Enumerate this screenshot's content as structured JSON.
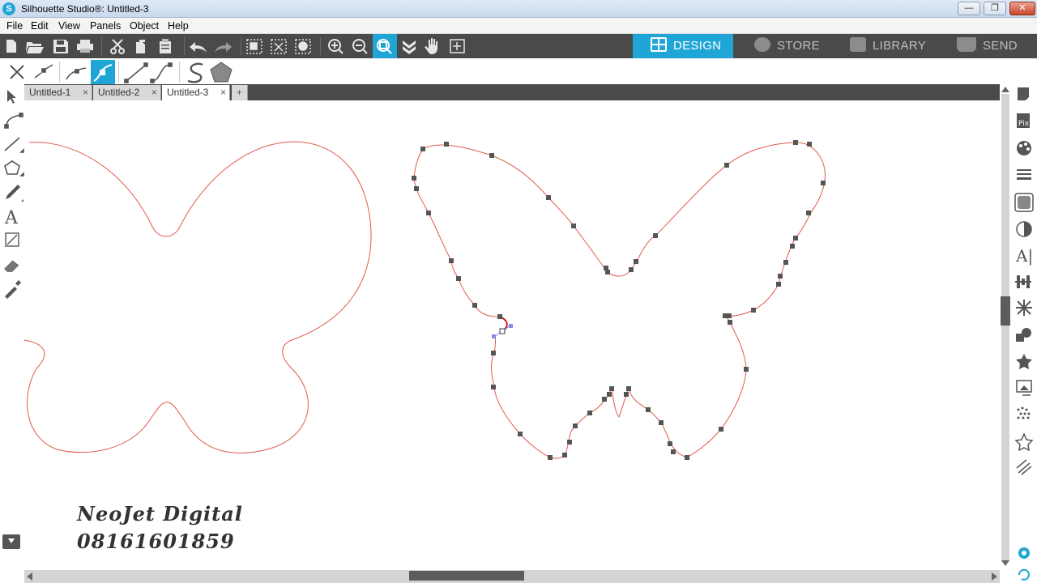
{
  "window": {
    "title": "Silhouette Studio®: Untitled-3",
    "logo": "S",
    "minimize": "—",
    "maximize": "❐",
    "close": "✕"
  },
  "menu": [
    "File",
    "Edit",
    "View",
    "Panels",
    "Object",
    "Help"
  ],
  "nav_tabs": [
    {
      "label": "DESIGN",
      "active": true
    },
    {
      "label": "STORE",
      "active": false
    },
    {
      "label": "LIBRARY",
      "active": false
    },
    {
      "label": "SEND",
      "active": false
    }
  ],
  "doc_tabs": [
    {
      "label": "Untitled-1",
      "close": "×"
    },
    {
      "label": "Untitled-2",
      "close": "×"
    },
    {
      "label": "Untitled-3",
      "close": "×",
      "active": true
    }
  ],
  "add_tab": "+",
  "watermark": {
    "line1": "NeoJet Digital",
    "line2": "08161601859"
  },
  "colors": {
    "accent": "#1fa6d6",
    "toolbar": "#4a4a4a",
    "cut_line": "#e05a4a",
    "point": "#555555"
  },
  "icons": {
    "toolbar": [
      "new-file-icon",
      "open-icon",
      "save-icon",
      "print-icon",
      "cut-icon",
      "copy-icon",
      "paste-icon",
      "undo-icon",
      "redo-icon",
      "group-icon",
      "ungroup-icon",
      "compound-icon",
      "zoom-in-icon",
      "zoom-out-icon",
      "zoom-fit-icon",
      "pan-down-icon",
      "hand-icon",
      "zoom-page-icon"
    ],
    "edit_points": [
      "delete-point-icon",
      "break-path-icon",
      "corner-point-icon",
      "smooth-point-icon",
      "straighten-icon",
      "curve-icon",
      "simplify-icon",
      "polygon-icon"
    ],
    "left_tools": [
      "select-icon",
      "edit-points-icon",
      "line-icon",
      "polygon-icon",
      "pencil-icon",
      "text-icon",
      "knife-icon",
      "eraser-icon",
      "eyedropper-icon"
    ],
    "right_panel": [
      "page-setup-icon",
      "pixscan-icon",
      "fill-color-icon",
      "line-style-icon",
      "trace-icon",
      "half-tone-icon",
      "text-style-icon",
      "align-icon",
      "replicate-icon",
      "modify-icon",
      "offset-icon",
      "transform-icon",
      "sketch-icon",
      "library-star-icon",
      "hatch-icon",
      "settings-icon",
      "refresh-icon"
    ]
  }
}
